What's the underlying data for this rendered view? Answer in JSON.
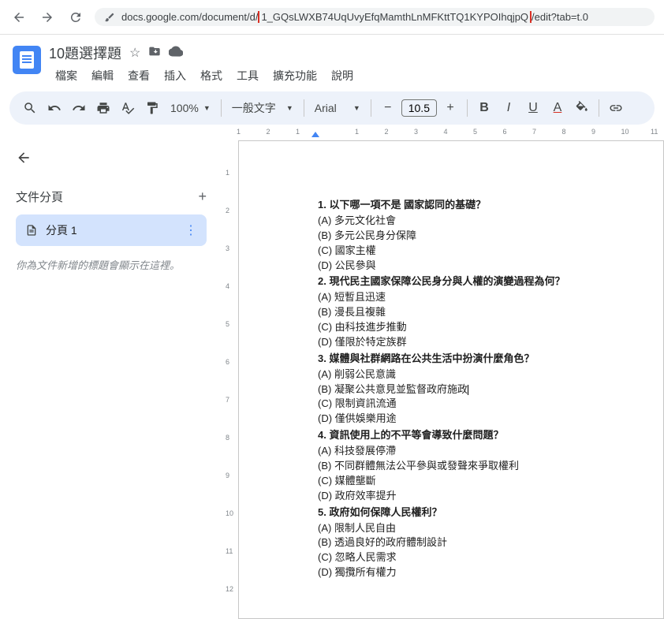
{
  "browser": {
    "url_prefix": "docs.google.com/document/d/",
    "url_id": "1_GQsLWXB74UqUvyEfqMamthLnMFKttTQ1KYPOIhqjpQ",
    "url_suffix": "/edit?tab=t.0"
  },
  "header": {
    "title": "10題選擇題",
    "menus": [
      "檔案",
      "編輯",
      "查看",
      "插入",
      "格式",
      "工具",
      "擴充功能",
      "說明"
    ]
  },
  "toolbar": {
    "zoom": "100%",
    "style": "一般文字",
    "font": "Arial",
    "fontsize": "10.5"
  },
  "sidebar": {
    "outline_label": "文件分頁",
    "tab_label": "分頁 1",
    "hint": "你為文件新增的標題會顯示在這裡。"
  },
  "ruler_h": [
    "1",
    "2",
    "1",
    "",
    "1",
    "2",
    "3",
    "4",
    "5",
    "6",
    "7",
    "8",
    "9",
    "10",
    "11"
  ],
  "ruler_v": [
    "1",
    "2",
    "3",
    "4",
    "5",
    "6",
    "7",
    "8",
    "9",
    "10",
    "11",
    "12"
  ],
  "questions": [
    {
      "title": "1. 以下哪一項不是 國家認同的基礎？",
      "opts": [
        "(A) 多元文化社會",
        "(B) 多元公民身分保障",
        "(C) 國家主權",
        "(D) 公民參與"
      ]
    },
    {
      "title": "2. 現代民主國家保障公民身分與人權的演變過程為何？",
      "opts": [
        "(A) 短暫且迅速",
        "(B) 漫長且複雜",
        "(C) 由科技進步推動",
        "(D) 僅限於特定族群"
      ]
    },
    {
      "title": "3. 媒體與社群網路在公共生活中扮演什麼角色？",
      "opts": [
        "(A) 削弱公民意識",
        "(B) 凝聚公共意見並監督政府施政",
        "(C) 限制資訊流通",
        "(D) 僅供娛樂用途"
      ]
    },
    {
      "title": "4. 資訊使用上的不平等會導致什麼問題？",
      "opts": [
        "(A) 科技發展停滯",
        "(B) 不同群體無法公平參與或發聲來爭取權利",
        "(C) 媒體壟斷",
        "(D) 政府效率提升"
      ]
    },
    {
      "title": "5. 政府如何保障人民權利？",
      "opts": [
        "(A) 限制人民自由",
        "(B) 透過良好的政府體制設計",
        "(C) 忽略人民需求",
        "(D) 獨攬所有權力"
      ]
    }
  ]
}
